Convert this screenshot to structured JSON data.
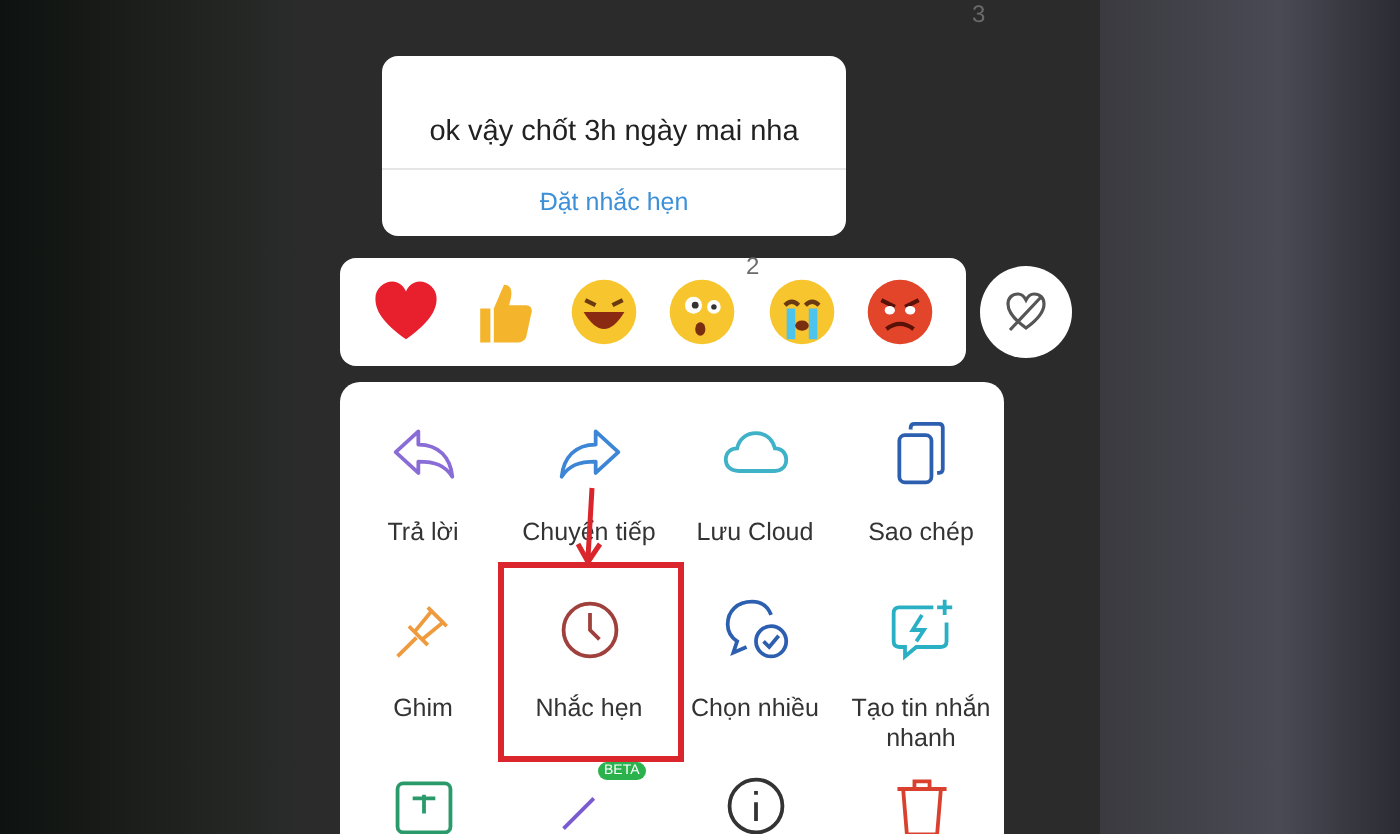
{
  "chat_background": {
    "reaction_counts": [
      "3",
      "2"
    ]
  },
  "message_popup": {
    "text": "ok vậy chốt 3h ngày mai nha",
    "action": "Đặt nhắc hẹn"
  },
  "reactions": [
    {
      "kind": "heart"
    },
    {
      "kind": "thumbs"
    },
    {
      "kind": "laugh"
    },
    {
      "kind": "surprised"
    },
    {
      "kind": "cry"
    },
    {
      "kind": "angry"
    }
  ],
  "menu": {
    "items": [
      {
        "kind": "reply",
        "label": "Trả lời",
        "highlighted": false
      },
      {
        "kind": "forward",
        "label": "Chuyển tiếp",
        "highlighted": false
      },
      {
        "kind": "cloud",
        "label": "Lưu Cloud",
        "highlighted": false
      },
      {
        "kind": "copy",
        "label": "Sao chép",
        "highlighted": false
      },
      {
        "kind": "pin",
        "label": "Ghim",
        "highlighted": false
      },
      {
        "kind": "clock",
        "label": "Nhắc hẹn",
        "highlighted": true
      },
      {
        "kind": "multi",
        "label": "Chọn nhiều",
        "highlighted": false
      },
      {
        "kind": "quick",
        "label": "Tạo tin nhắn nhanh",
        "highlighted": false
      },
      {
        "kind": "translate",
        "highlighted": false
      },
      {
        "kind": "beta",
        "badge": "BETA",
        "highlighted": false
      },
      {
        "kind": "info",
        "highlighted": false
      },
      {
        "kind": "trash",
        "highlighted": false
      }
    ]
  }
}
